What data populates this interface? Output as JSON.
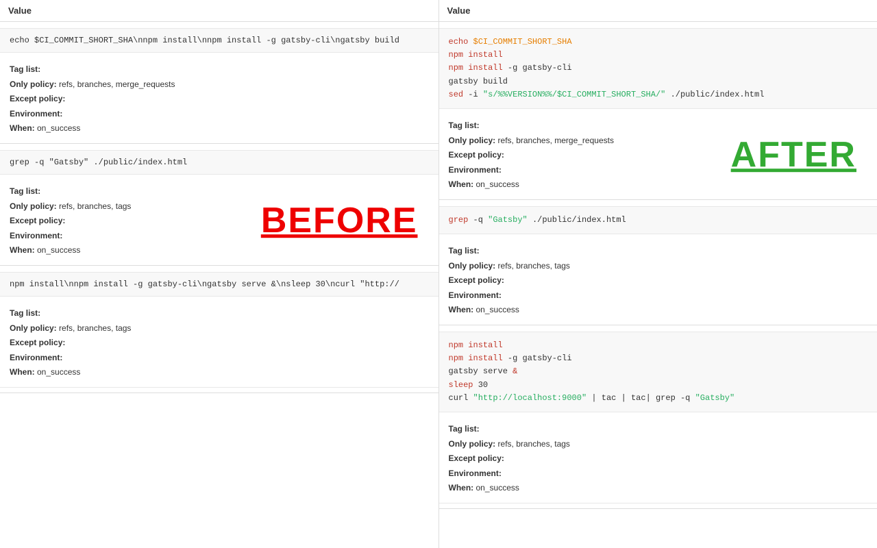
{
  "left": {
    "header": "Value",
    "sections": [
      {
        "id": "section-1",
        "code_plain": "echo $CI_COMMIT_SHORT_SHA\\nnpm install\\nnpm install -g gatsby-cli\\ngatsby build",
        "meta": {
          "tag_list": "Tag list:",
          "only_policy_label": "Only policy:",
          "only_policy_value": "refs, branches, merge_requests",
          "except_policy_label": "Except policy:",
          "except_policy_value": "",
          "environment_label": "Environment:",
          "environment_value": "",
          "when_label": "When:",
          "when_value": "on_success"
        }
      },
      {
        "id": "section-2",
        "code_plain": "grep -q \"Gatsby\" ./public/index.html",
        "meta": {
          "tag_list": "Tag list:",
          "only_policy_label": "Only policy:",
          "only_policy_value": "refs, branches, tags",
          "except_policy_label": "Except policy:",
          "except_policy_value": "",
          "environment_label": "Environment:",
          "environment_value": "",
          "when_label": "When:",
          "when_value": "on_success"
        },
        "before_label": "BEFORE"
      },
      {
        "id": "section-3",
        "code_plain": "npm install\\nnpm install -g gatsby-cli\\ngatsby serve &\\nsleep 30\\ncurl \"http://",
        "meta": {
          "tag_list": "Tag list:",
          "only_policy_label": "Only policy:",
          "only_policy_value": "refs, branches, tags",
          "except_policy_label": "Except policy:",
          "except_policy_value": "",
          "environment_label": "Environment:",
          "environment_value": "",
          "when_label": "When:",
          "when_value": "on_success"
        }
      }
    ]
  },
  "right": {
    "header": "Value",
    "sections": [
      {
        "id": "r-section-1",
        "meta": {
          "tag_list": "Tag list:",
          "only_policy_label": "Only policy:",
          "only_policy_value": "refs, branches, merge_requests",
          "except_policy_label": "Except policy:",
          "except_policy_value": "",
          "environment_label": "Environment:",
          "environment_value": "",
          "when_label": "When:",
          "when_value": "on_success"
        },
        "after_label": "AFTER"
      },
      {
        "id": "r-section-2",
        "meta": {
          "tag_list": "Tag list:",
          "only_policy_label": "Only policy:",
          "only_policy_value": "refs, branches, tags",
          "except_policy_label": "Except policy:",
          "except_policy_value": "",
          "environment_label": "Environment:",
          "environment_value": "",
          "when_label": "When:",
          "when_value": "on_success"
        }
      },
      {
        "id": "r-section-3",
        "meta": {
          "tag_list": "Tag list:",
          "only_policy_label": "Only policy:",
          "only_policy_value": "refs, branches, tags",
          "except_policy_label": "Except policy:",
          "except_policy_value": "",
          "environment_label": "Environment:",
          "environment_value": "",
          "when_label": "When:",
          "when_value": "on_success"
        }
      }
    ]
  },
  "labels": {
    "before": "BEFORE",
    "after": "AFTER",
    "tag_list": "Tag list:",
    "only_policy": "Only policy:",
    "except_policy": "Except policy:",
    "environment": "Environment:",
    "when": "When:",
    "on_success": "on_success"
  }
}
